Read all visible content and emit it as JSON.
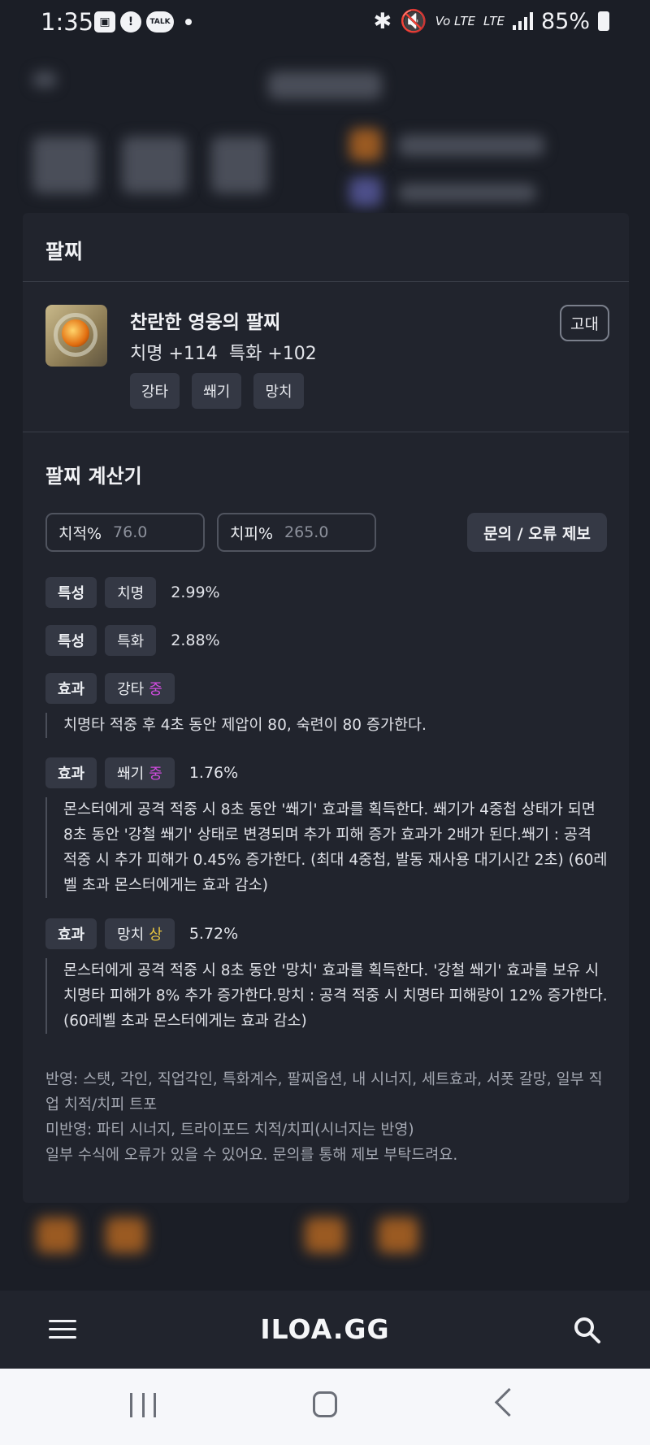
{
  "status_bar": {
    "time": "1:35",
    "talk_label": "TALK",
    "volte_label": "Vo LTE",
    "lte_label": "LTE",
    "battery": "85%"
  },
  "modal": {
    "title": "팔찌",
    "item": {
      "name": "찬란한 영웅의 팔찌",
      "stats": [
        "치명 +114",
        "특화 +102"
      ],
      "grade": "고대",
      "tags": [
        "강타",
        "쐐기",
        "망치"
      ]
    },
    "calculator": {
      "title": "팔찌 계산기",
      "crit_rate": {
        "label": "치적%",
        "value": "76.0"
      },
      "crit_damage": {
        "label": "치피%",
        "value": "265.0"
      },
      "report_button": "문의 / 오류 제보",
      "rows": [
        {
          "type": "특성",
          "name": "치명",
          "value": "2.99%"
        },
        {
          "type": "특성",
          "name": "특화",
          "value": "2.88%"
        },
        {
          "type": "효과",
          "name": "강타",
          "level": "중",
          "value": "",
          "desc": "치명타 적중 후 4초 동안 제압이 80, 숙련이 80 증가한다."
        },
        {
          "type": "효과",
          "name": "쐐기",
          "level": "중",
          "value": "1.76%",
          "desc": "몬스터에게 공격 적중 시 8초 동안 '쐐기' 효과를 획득한다. 쐐기가 4중첩 상태가 되면 8초 동안 '강철 쐐기' 상태로 변경되며 추가 피해 증가 효과가 2배가 된다.쐐기 : 공격 적중 시 추가 피해가 0.45% 증가한다. (최대 4중첩, 발동 재사용 대기시간 2초) (60레벨 초과 몬스터에게는 효과 감소)"
        },
        {
          "type": "효과",
          "name": "망치",
          "level": "상",
          "value": "5.72%",
          "desc": "몬스터에게 공격 적중 시 8초 동안 '망치' 효과를 획득한다. '강철 쐐기' 효과를 보유 시 치명타 피해가 8% 추가 증가한다.망치 : 공격 적중 시 치명타 피해량이 12% 증가한다. (60레벨 초과 몬스터에게는 효과 감소)"
        }
      ],
      "notes": [
        "반영: 스탯, 각인, 직업각인, 특화계수, 팔찌옵션, 내 시너지, 세트효과, 서폿 갈망, 일부 직업 치적/치피 트포",
        "미반영: 파티 시너지, 트라이포드 치적/치피(시너지는 반영)",
        "일부 수식에 오류가 있을 수 있어요. 문의를 통해 제보 부탁드려요."
      ]
    }
  },
  "app_bar": {
    "logo": "ILOA.GG"
  },
  "colors": {
    "level_mid": "#d24ce0",
    "level_high": "#e6c440",
    "background": "#191c24",
    "modal": "#21242d"
  }
}
